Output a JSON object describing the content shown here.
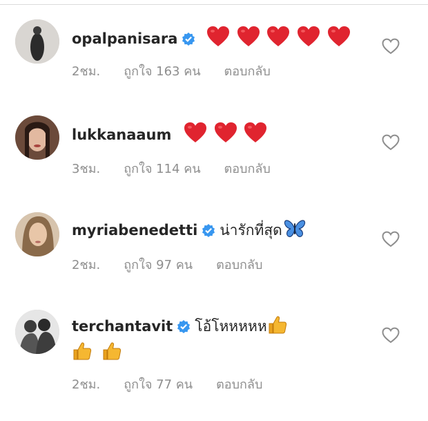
{
  "comments": [
    {
      "username": "opalpanisara",
      "verified": true,
      "text": "",
      "emojis": [
        "heart",
        "heart",
        "heart",
        "heart",
        "heart"
      ],
      "time": "2ชม.",
      "likes": "ถูกใจ 163 คน",
      "reply": "ตอบกลับ"
    },
    {
      "username": "lukkanaaum",
      "verified": false,
      "text": "",
      "emojis": [
        "heart",
        "heart",
        "heart"
      ],
      "time": "3ชม.",
      "likes": "ถูกใจ 114 คน",
      "reply": "ตอบกลับ"
    },
    {
      "username": "myriabenedetti",
      "verified": true,
      "text": "น่ารักที่สุด",
      "emojis": [
        "butterfly"
      ],
      "time": "2ชม.",
      "likes": "ถูกใจ 97 คน",
      "reply": "ตอบกลับ"
    },
    {
      "username": "terchantavit",
      "verified": true,
      "text": "โอ้โหหหหห",
      "emojis": [
        "thumbs-up",
        "thumbs-up",
        "thumbs-up"
      ],
      "time": "2ชม.",
      "likes": "ถูกใจ 77 คน",
      "reply": "ตอบกลับ"
    }
  ],
  "colors": {
    "verified_blue": "#3897f0",
    "heart_red": "#e0242f",
    "meta_gray": "#8e8e8e",
    "thumb_yellow": "#f5b731"
  }
}
